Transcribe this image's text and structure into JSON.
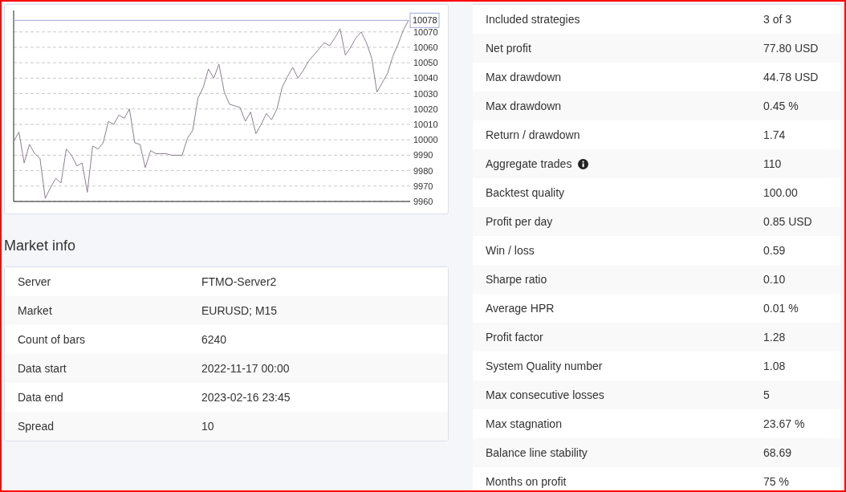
{
  "balance_chart": {
    "chart_data": {
      "type": "line",
      "ylim": [
        9960,
        10078
      ],
      "yticks": [
        9960,
        9970,
        9980,
        9990,
        10000,
        10010,
        10020,
        10030,
        10040,
        10050,
        10060,
        10070
      ],
      "categories": [
        null,
        null,
        null,
        null,
        null,
        null,
        null,
        null,
        null,
        null,
        null,
        null,
        null,
        null,
        null,
        null,
        null,
        null,
        null,
        null,
        null,
        null,
        null,
        null,
        null,
        null,
        null,
        null,
        null,
        null,
        null,
        null,
        null,
        null,
        null,
        null,
        null,
        null,
        null,
        null,
        null,
        null,
        null,
        null,
        null,
        null,
        null,
        null,
        null,
        null,
        null,
        null,
        null,
        null,
        null,
        null,
        null,
        null,
        null,
        null,
        null,
        null,
        null,
        null,
        null,
        null,
        null,
        null,
        null,
        null,
        null,
        null,
        null,
        null,
        null,
        null
      ],
      "series": [
        {
          "color": "#8c7f8f",
          "values": [
            9999,
            10005,
            9985,
            9997,
            9991,
            9988,
            9962,
            9969,
            9975,
            9972,
            9994,
            9990,
            9983,
            9985,
            9966,
            9996,
            9994,
            9998,
            10012,
            10010,
            10016,
            10014,
            10020,
            9998,
            9997,
            9982,
            9993,
            9991,
            9991,
            9991,
            9990,
            9990,
            9990,
            10001,
            10006,
            10027,
            10034,
            10046,
            10040,
            10049,
            10031,
            10023,
            10022,
            10021,
            10012,
            10018,
            10004,
            10010,
            10017,
            10013,
            10020,
            10034,
            10041,
            10047,
            10040,
            10045,
            10051,
            10055,
            10059,
            10063,
            10061,
            10066,
            10072,
            10055,
            10060,
            10066,
            10070,
            10063,
            10053,
            10031,
            10037,
            10043,
            10054,
            10062,
            10071,
            10077.5
          ]
        }
      ],
      "grid": true
    },
    "current_value": "10078"
  },
  "market_info": {
    "title": "Market info",
    "rows": [
      {
        "label": "Server",
        "value": "FTMO-Server2"
      },
      {
        "label": "Market",
        "value": "EURUSD; M15"
      },
      {
        "label": "Count of bars",
        "value": "6240"
      },
      {
        "label": "Data start",
        "value": "2022-11-17 00:00"
      },
      {
        "label": "Data end",
        "value": "2023-02-16 23:45"
      },
      {
        "label": "Spread",
        "value": "10"
      }
    ]
  },
  "stats": {
    "rows": [
      {
        "label": "Included strategies",
        "value": "3 of 3",
        "info": false
      },
      {
        "label": "Net profit",
        "value": "77.80 USD",
        "info": false
      },
      {
        "label": "Max drawdown",
        "value": "44.78 USD",
        "info": false
      },
      {
        "label": "Max drawdown",
        "value": "0.45 %",
        "info": false
      },
      {
        "label": "Return / drawdown",
        "value": "1.74",
        "info": false
      },
      {
        "label": "Aggregate trades",
        "value": "110",
        "info": true
      },
      {
        "label": "Backtest quality",
        "value": "100.00",
        "info": false
      },
      {
        "label": "Profit per day",
        "value": "0.85 USD",
        "info": false
      },
      {
        "label": "Win / loss",
        "value": "0.59",
        "info": false
      },
      {
        "label": "Sharpe ratio",
        "value": "0.10",
        "info": false
      },
      {
        "label": "Average HPR",
        "value": "0.01 %",
        "info": false
      },
      {
        "label": "Profit factor",
        "value": "1.28",
        "info": false
      },
      {
        "label": "System Quality number",
        "value": "1.08",
        "info": false
      },
      {
        "label": "Max consecutive losses",
        "value": "5",
        "info": false
      },
      {
        "label": "Max stagnation",
        "value": "23.67 %",
        "info": false
      },
      {
        "label": "Balance line stability",
        "value": "68.69",
        "info": false
      },
      {
        "label": "Months on profit",
        "value": "75 %",
        "info": false
      }
    ]
  }
}
